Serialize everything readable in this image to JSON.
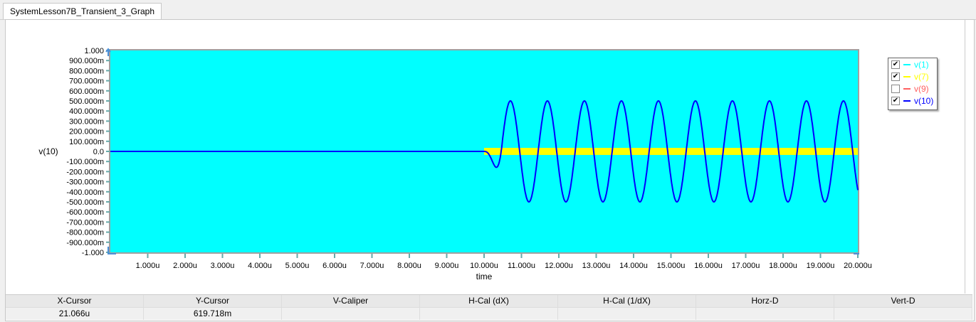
{
  "tab": {
    "title": "SystemLesson7B_Transient_3_Graph"
  },
  "chart_data": {
    "type": "line",
    "xlabel": "time",
    "ylabel": "v(10)",
    "xlim": [
      0,
      20
    ],
    "ylim": [
      -1,
      1
    ],
    "x_unit": "us",
    "xticks": [
      "1.000u",
      "2.000u",
      "3.000u",
      "4.000u",
      "5.000u",
      "6.000u",
      "7.000u",
      "8.000u",
      "9.000u",
      "10.000u",
      "11.000u",
      "12.000u",
      "13.000u",
      "14.000u",
      "15.000u",
      "16.000u",
      "17.000u",
      "18.000u",
      "19.000u",
      "20.000u"
    ],
    "yticks": [
      "1.000",
      "900.000m",
      "800.000m",
      "700.000m",
      "600.000m",
      "500.000m",
      "400.000m",
      "300.000m",
      "200.000m",
      "100.000m",
      "0.0",
      "-100.000m",
      "-200.000m",
      "-300.000m",
      "-400.000m",
      "-500.000m",
      "-600.000m",
      "-700.000m",
      "-800.000m",
      "-900.000m",
      "-1.000"
    ],
    "series": [
      {
        "name": "v(1)",
        "color": "#00ffff",
        "checked": true,
        "kind": "band",
        "x_range": [
          0,
          20
        ],
        "y_range": [
          -1,
          1
        ]
      },
      {
        "name": "v(7)",
        "color": "#ffff00",
        "checked": true,
        "kind": "band",
        "x_range": [
          10,
          20
        ],
        "y_range": [
          -0.035,
          0.035
        ]
      },
      {
        "name": "v(9)",
        "color": "#ff6060",
        "checked": false,
        "kind": "hidden"
      },
      {
        "name": "v(10)",
        "color": "#0000ff",
        "checked": true,
        "kind": "sine",
        "flat_until": 10,
        "amplitude": 0.5,
        "period": 0.99,
        "first_peak": 10.705,
        "ramp_end": 10.5
      }
    ],
    "legend_position": "right"
  },
  "cursor_table": {
    "headers": [
      "X-Cursor",
      "Y-Cursor",
      "V-Caliper",
      "H-Cal (dX)",
      "H-Cal (1/dX)",
      "Horz-D",
      "Vert-D"
    ],
    "values": [
      "21.066u",
      "619.718m",
      "",
      "",
      "",
      "",
      ""
    ]
  }
}
